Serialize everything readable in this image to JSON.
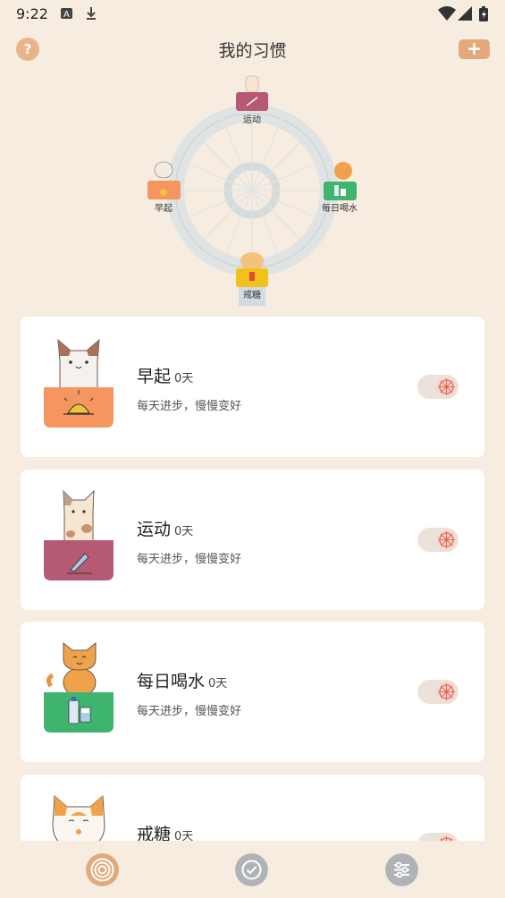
{
  "status": {
    "time": "9:22"
  },
  "header": {
    "help": "?",
    "title": "我的习惯",
    "add": "+"
  },
  "wheel": {
    "labels": [
      "运动",
      "早起",
      "每日喝水",
      "戒糖"
    ]
  },
  "habits": [
    {
      "name": "早起",
      "days": "0天",
      "subtitle": "每天进步，慢慢变好",
      "color": "#f5955f"
    },
    {
      "name": "运动",
      "days": "0天",
      "subtitle": "每天进步，慢慢变好",
      "color": "#b55a73"
    },
    {
      "name": "每日喝水",
      "days": "0天",
      "subtitle": "每天进步，慢慢变好",
      "color": "#3fb46e"
    },
    {
      "name": "戒糖",
      "days": "0天",
      "subtitle": "",
      "color": "#f1c21b"
    }
  ],
  "nav": {
    "items": [
      "habits",
      "check-in",
      "settings"
    ]
  },
  "colors": {
    "background": "#f7ece0",
    "accent": "#e3a97c",
    "card": "#ffffff"
  }
}
